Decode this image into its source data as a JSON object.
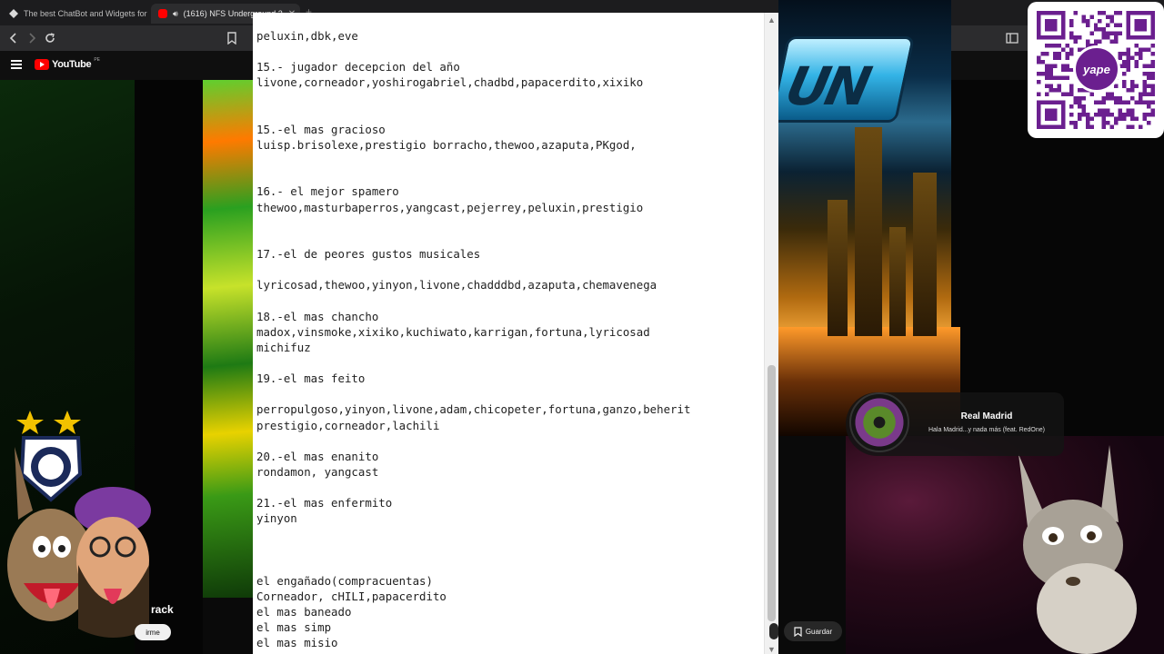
{
  "browser": {
    "tabs": [
      {
        "title": "The best ChatBot and Widgets for Ki",
        "favicon_color": "#6b6b6b"
      },
      {
        "title": "(1616) NFS Underground 2",
        "favicon_color": "#ff0000",
        "active": true
      }
    ],
    "icons": [
      "back-icon",
      "forward-icon",
      "reload-icon",
      "bookmark-icon",
      "cast-icon",
      "zoom-icon",
      "share-icon",
      "brave-shield-icon",
      "extensions-icon",
      "sidebar-icon"
    ]
  },
  "youtube": {
    "logo": "YouTube",
    "country": "PE",
    "channel_fragment": "rack",
    "subscribe_fragment": "irme",
    "save_label": "Guardar"
  },
  "document": {
    "lines": [
      "peluxin,dbk,eve",
      "",
      "15.- jugador decepcion del año",
      "livone,corneador,yoshirogabriel,chadbd,papacerdito,xixiko",
      "",
      "",
      "15.-el mas gracioso",
      "luisp.brisolexe,prestigio borracho,thewoo,azaputa,PKgod,",
      "",
      "",
      "16.- el mejor spamero",
      "thewoo,masturbaperros,yangcast,pejerrey,peluxin,prestigio",
      "",
      "",
      "17.-el de peores gustos musicales",
      "",
      "lyricosad,thewoo,yinyon,livone,chadddbd,azaputa,chemavenega",
      "",
      "18.-el mas chancho",
      "madox,vinsmoke,xixiko,kuchiwato,karrigan,fortuna,lyricosad",
      "michifuz",
      "",
      "19.-el mas feito",
      "",
      "perropulgoso,yinyon,livone,adam,chicopeter,fortuna,ganzo,beherit",
      "prestigio,corneador,lachili",
      "",
      "20.-el mas enanito",
      "rondamon, yangcast",
      "",
      "21.-el mas enfermito",
      "yinyon",
      "",
      "",
      "",
      "el engañado(compracuentas)",
      "Corneador, cHILI,papacerdito",
      "el mas baneado",
      "el mas simp",
      "el mas misio"
    ]
  },
  "qr": {
    "brand": "yape",
    "accent": "#6b1f8f"
  },
  "music": {
    "artist": "Real Madrid",
    "track": "Hala Madrid...y nada más (feat. RedOne)"
  },
  "colors": {
    "yt_red": "#ff0000",
    "doc_bg": "#ffffff",
    "dark_bg": "#0f0f0f"
  }
}
